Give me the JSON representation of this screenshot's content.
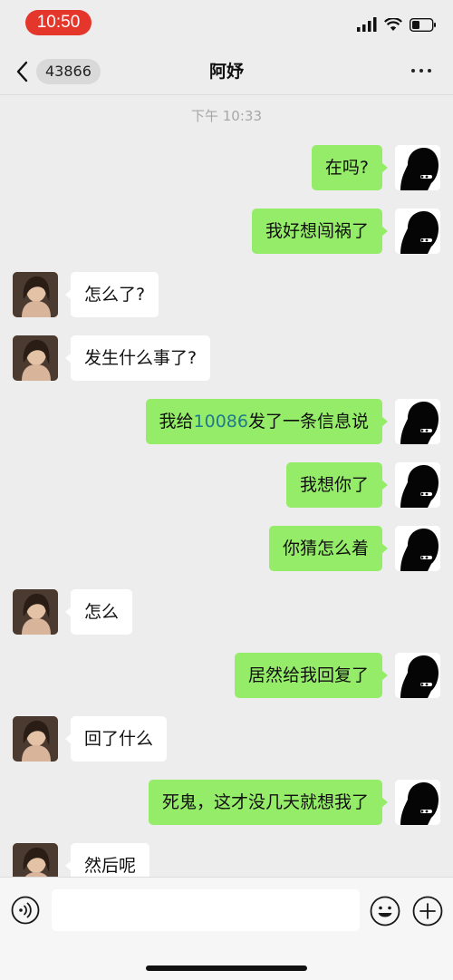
{
  "status_bar": {
    "time": "10:50"
  },
  "nav": {
    "back_label": "<",
    "unread_count": "43866",
    "title": "阿妤",
    "more_icon": "more-dots-icon"
  },
  "chat": {
    "timestamp": "下午 10:33",
    "colors": {
      "outgoing_bubble": "#95ec69",
      "incoming_bubble": "#ffffff",
      "background": "#ededed",
      "number_link": "#1f7a8c"
    },
    "messages": [
      {
        "from": "self",
        "text": "在吗?"
      },
      {
        "from": "self",
        "text": "我好想闯祸了"
      },
      {
        "from": "other",
        "text": "怎么了?"
      },
      {
        "from": "other",
        "text": "发生什么事了?"
      },
      {
        "from": "self",
        "text_before": "我给",
        "number": "10086",
        "text_after": "发了一条信息说"
      },
      {
        "from": "self",
        "text": "我想你了"
      },
      {
        "from": "self",
        "text": "你猜怎么着"
      },
      {
        "from": "other",
        "text": "怎么"
      },
      {
        "from": "self",
        "text": "居然给我回复了"
      },
      {
        "from": "other",
        "text": "回了什么"
      },
      {
        "from": "self",
        "text": "死鬼，这才没几天就想我了"
      },
      {
        "from": "other",
        "text": "然后呢"
      }
    ]
  },
  "input_bar": {
    "voice_icon": "voice-icon",
    "emoji_icon": "emoji-icon",
    "plus_icon": "plus-icon",
    "placeholder": ""
  }
}
